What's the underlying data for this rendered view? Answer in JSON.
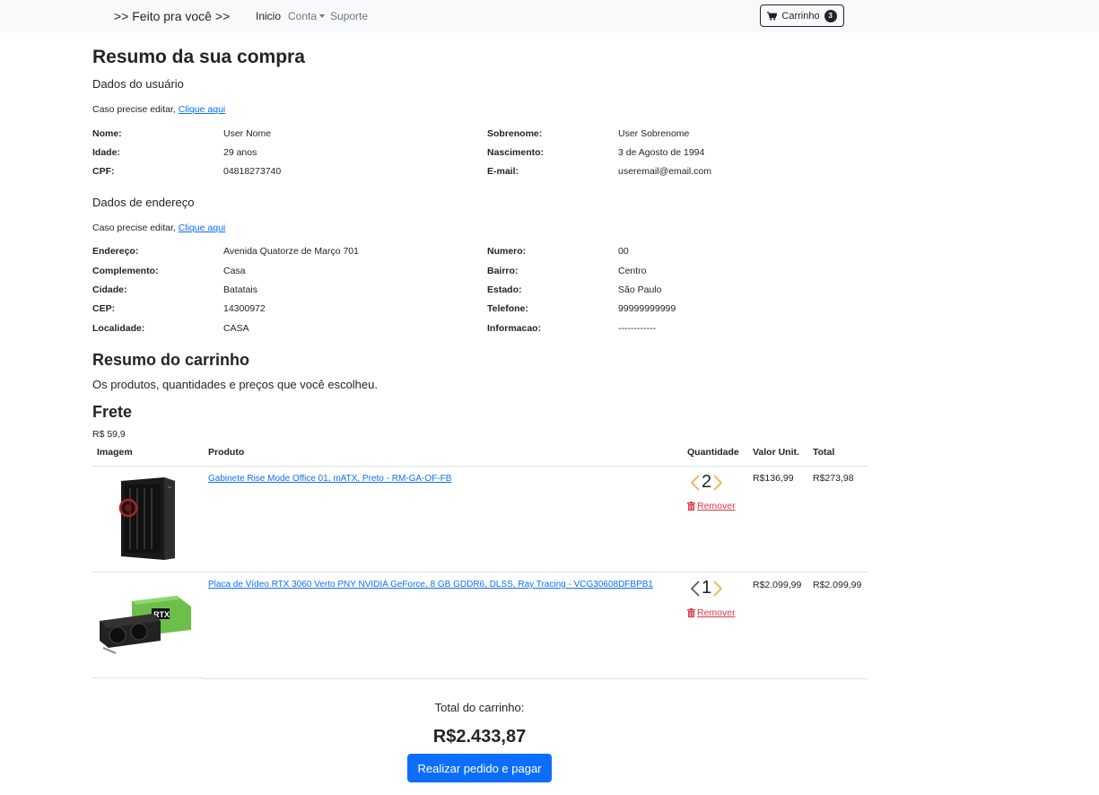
{
  "navbar": {
    "brand": ">> Feito pra você >>",
    "links": [
      "Inicio",
      "Conta",
      "Suporte"
    ],
    "cart_label": "Carrinho",
    "cart_count": "3"
  },
  "page_title": "Resumo da sua compra",
  "user_section": {
    "heading": "Dados do usuário",
    "edit_prefix": "Caso precise editar, ",
    "edit_link": "Clique aqui",
    "left": [
      {
        "label": "Nome:",
        "value": "User Nome"
      },
      {
        "label": "Idade:",
        "value": "29 anos"
      },
      {
        "label": "CPF:",
        "value": "04818273740"
      }
    ],
    "right": [
      {
        "label": "Sobrenome:",
        "value": "User Sobrenome"
      },
      {
        "label": "Nascimento:",
        "value": "3 de Agosto de 1994"
      },
      {
        "label": "E-mail:",
        "value": "useremail@email.com"
      }
    ]
  },
  "address_section": {
    "heading": "Dados de endereço",
    "edit_prefix": "Caso precise editar, ",
    "edit_link": "Clique aqui",
    "left": [
      {
        "label": "Endereço:",
        "value": "Avenida Quatorze de Março 701"
      },
      {
        "label": "Complemento:",
        "value": "Casa"
      },
      {
        "label": "Cidade:",
        "value": "Batatais"
      },
      {
        "label": "CEP:",
        "value": "14300972"
      },
      {
        "label": "Localidade:",
        "value": "CASA"
      }
    ],
    "right": [
      {
        "label": "Numero:",
        "value": "00"
      },
      {
        "label": "Bairro:",
        "value": "Centro"
      },
      {
        "label": "Estado:",
        "value": "São Paulo"
      },
      {
        "label": "Telefone:",
        "value": "99999999999"
      },
      {
        "label": "Informacao:",
        "value": "------------"
      }
    ]
  },
  "cart_section": {
    "heading": "Resumo do carrinho",
    "subheading": "Os produtos, quantidades e preços que você escolheu."
  },
  "shipping": {
    "heading": "Frete",
    "value": "R$ 59,9"
  },
  "table": {
    "headers": [
      "Imagem",
      "Produto",
      "Quantidade",
      "Valor Unit.",
      "Total"
    ],
    "rows": [
      {
        "image_icon": "pc-case-image",
        "product": "Gabinete Rise Mode Office 01, mATX, Preto - RM-GA-OF-FB",
        "quantity": "2",
        "remove": "Remover",
        "unit_price": "R$136,99",
        "total": "R$273,98"
      },
      {
        "image_icon": "graphics-card-image",
        "product": "Placa de Vídeo RTX 3060 Verto PNY NVIDIA GeForce, 8 GB GDDR6, DLSS, Ray Tracing - VCG30608DFBPB1",
        "quantity": "1",
        "remove": "Remover",
        "unit_price": "R$2.099,99",
        "total": "R$2.099,99"
      }
    ]
  },
  "summary": {
    "label": "Total do carrinho:",
    "value": "R$2.433,87",
    "button": "Realizar pedido e pagar"
  },
  "colors": {
    "accent": "#0d6efd",
    "danger": "#dc3545",
    "chevron_active": "#f0ad4e",
    "navbar_bg": "#f8f9fa"
  }
}
